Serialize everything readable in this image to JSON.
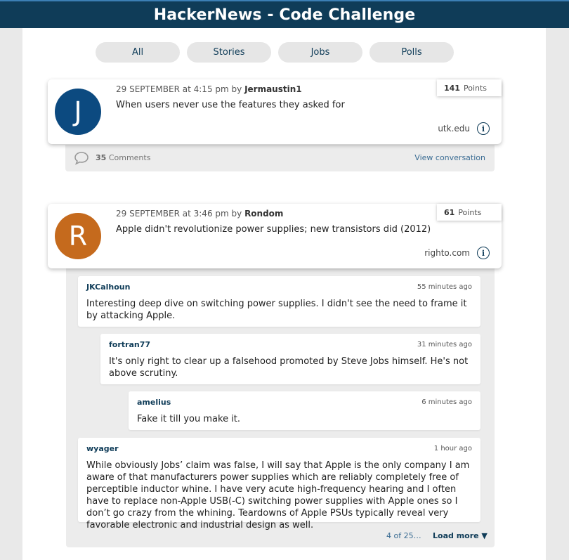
{
  "header": {
    "title": "HackerNews - Code Challenge"
  },
  "tabs": [
    {
      "label": "All"
    },
    {
      "label": "Stories"
    },
    {
      "label": "Jobs"
    },
    {
      "label": "Polls"
    }
  ],
  "stories": [
    {
      "avatar_letter": "J",
      "avatar_color": "#0c4a80",
      "date": "29 SEPTEMBER at 4:15 pm by",
      "author": "Jermaustin1",
      "title": "When users never use the features they asked for",
      "points_value": "141",
      "points_label": "Points",
      "domain": "utk.edu",
      "comments_count": "35",
      "comments_label": "Comments",
      "view_conversation": "View conversation"
    },
    {
      "avatar_letter": "R",
      "avatar_color": "#c56a1d",
      "date": "29 SEPTEMBER at 3:46 pm by",
      "author": "Rondom",
      "title": "Apple didn't revolutionize power supplies; new transistors did (2012)",
      "points_value": "61",
      "points_label": "Points",
      "domain": "righto.com"
    }
  ],
  "comments": [
    {
      "user": "JKCalhoun",
      "time": "55 minutes ago",
      "text": "Interesting deep dive on switching power supplies. I didn't see the need to frame it by attacking Apple."
    },
    {
      "user": "fortran77",
      "time": "31 minutes ago",
      "text": "It's only right to clear up a falsehood promoted by Steve Jobs himself. He's not above scrutiny."
    },
    {
      "user": "amelius",
      "time": "6 minutes ago",
      "text": "Fake it till you make it."
    },
    {
      "user": "wyager",
      "time": "1 hour ago",
      "text": "While obviously Jobs’ claim was false, I will say that Apple is the only company I am aware of that manufacturers power supplies which are reliably completely free of perceptible inductor whine. I have very acute high-frequency hearing and I often have to replace non-Apple USB(-C) switching power supplies with Apple ones so I don’t go crazy from the whining. Teardowns of Apple PSUs typically reveal very favorable electronic and industrial design as well."
    }
  ],
  "pagination": {
    "label": "4 of 25…",
    "load_more": "Load more ▼"
  },
  "icons": {
    "info": "info-icon",
    "comments": "speech-bubble-icon"
  }
}
